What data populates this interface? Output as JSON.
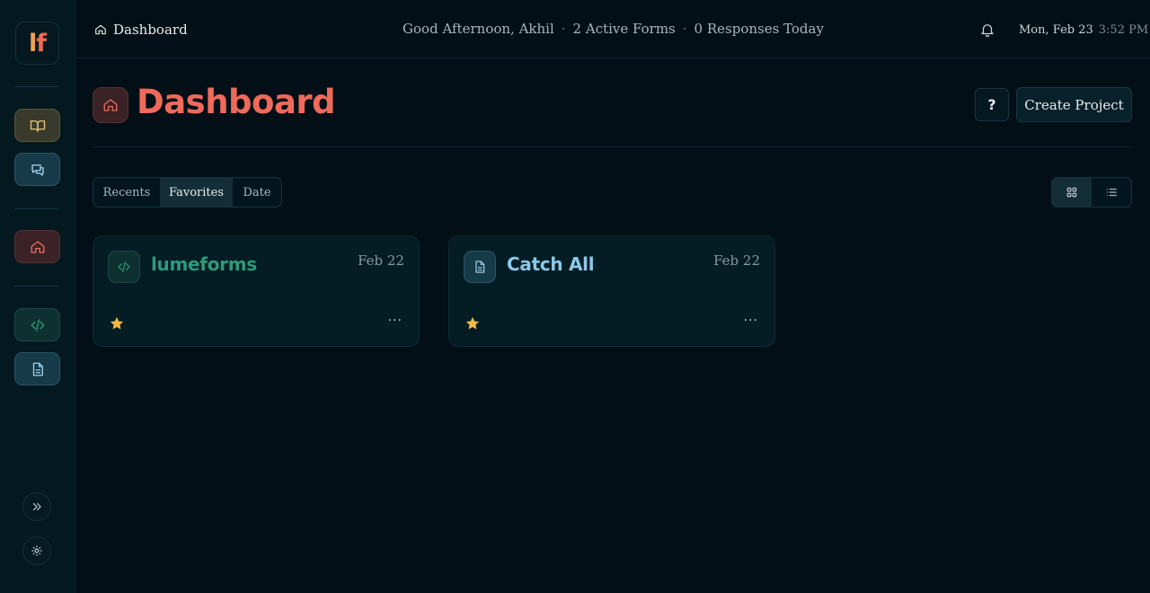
{
  "app": {
    "logo_l": "l",
    "logo_f": "f"
  },
  "topbar": {
    "breadcrumb": "Dashboard",
    "greeting": "Good Afternoon, Akhil",
    "active_forms": "2 Active Forms",
    "responses_today": "0 Responses Today",
    "separator": "·",
    "date": "Mon, Feb 23",
    "time": "3:52 PM"
  },
  "header": {
    "title": "Dashboard",
    "help_label": "?",
    "create_label": "Create Project"
  },
  "filters": {
    "tabs": [
      {
        "label": "Recents"
      },
      {
        "label": "Favorites",
        "active": true
      },
      {
        "label": "Date"
      }
    ]
  },
  "view": {
    "active": "grid"
  },
  "projects": [
    {
      "name": "lumeforms",
      "date": "Feb 22",
      "icon": "code-icon",
      "favorite": true,
      "more": "···",
      "color": "#2e9a7a"
    },
    {
      "name": "Catch All",
      "date": "Feb 22",
      "icon": "document-icon",
      "favorite": true,
      "more": "···",
      "color": "#8cc8e8"
    }
  ],
  "colors": {
    "background": "#020f17",
    "accent": "#ef6a5a",
    "star": "#f5b942"
  }
}
